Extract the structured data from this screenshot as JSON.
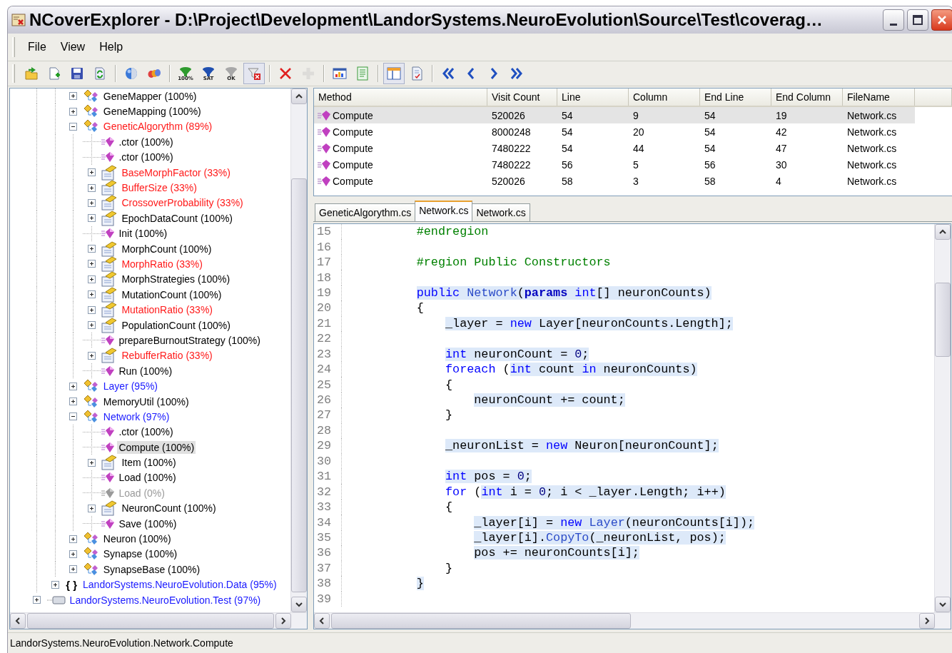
{
  "window": {
    "title": "NCoverExplorer - D:\\Project\\Development\\LandorSystems.NeuroEvolution\\Source\\Test\\coverag…"
  },
  "menu": [
    {
      "label": "File"
    },
    {
      "label": "View"
    },
    {
      "label": "Help"
    }
  ],
  "toolbar": [
    {
      "kind": "open",
      "pressed": false,
      "disabled": false
    },
    {
      "kind": "new",
      "pressed": false,
      "disabled": false
    },
    {
      "kind": "save",
      "pressed": false,
      "disabled": false
    },
    {
      "kind": "reload",
      "pressed": false,
      "disabled": false
    },
    {
      "kind": "separator"
    },
    {
      "kind": "sphere",
      "pressed": false,
      "disabled": false
    },
    {
      "kind": "chain",
      "pressed": false,
      "disabled": false
    },
    {
      "kind": "separator"
    },
    {
      "kind": "filter",
      "caption": "100%",
      "color": "#2e9a2e",
      "pressed": false,
      "disabled": false
    },
    {
      "kind": "filter",
      "caption": "SAT",
      "color": "#2050b0",
      "pressed": false,
      "disabled": false
    },
    {
      "kind": "filter",
      "caption": "OK",
      "color": "#a8a8a8",
      "pressed": false,
      "disabled": false
    },
    {
      "kind": "filter-clear",
      "pressed": true,
      "disabled": false
    },
    {
      "kind": "separator"
    },
    {
      "kind": "delete",
      "pressed": false,
      "disabled": false
    },
    {
      "kind": "add",
      "pressed": false,
      "disabled": true
    },
    {
      "kind": "separator"
    },
    {
      "kind": "report",
      "pressed": false,
      "disabled": false
    },
    {
      "kind": "sheet",
      "pressed": false,
      "disabled": false
    },
    {
      "kind": "separator"
    },
    {
      "kind": "layout",
      "pressed": true,
      "disabled": false
    },
    {
      "kind": "checklist",
      "pressed": false,
      "disabled": false
    },
    {
      "kind": "separator"
    },
    {
      "kind": "first",
      "pressed": false,
      "disabled": false
    },
    {
      "kind": "previous",
      "pressed": false,
      "disabled": false
    },
    {
      "kind": "next",
      "pressed": false,
      "disabled": false
    },
    {
      "kind": "last",
      "pressed": false,
      "disabled": false
    }
  ],
  "tree": {
    "items": [
      {
        "label": "GeneMapper (100%)",
        "kind": "class",
        "color": "#000000",
        "expanded": false,
        "selected": false
      },
      {
        "label": "GeneMapping (100%)",
        "kind": "class",
        "color": "#000000",
        "expanded": false,
        "selected": false
      },
      {
        "label": "GeneticAlgorythm (89%)",
        "kind": "class",
        "color": "#ff1a1a",
        "expanded": true,
        "selected": false,
        "children": [
          {
            "label": ".ctor (100%)",
            "kind": "method",
            "color": "#000000",
            "visited": true,
            "selected": false
          },
          {
            "label": ".ctor (100%)",
            "kind": "method",
            "color": "#000000",
            "visited": true,
            "selected": false
          },
          {
            "label": "BaseMorphFactor (33%)",
            "kind": "property",
            "color": "#ff1a1a",
            "expanded": false,
            "selected": false
          },
          {
            "label": "BufferSize (33%)",
            "kind": "property",
            "color": "#ff1a1a",
            "expanded": false,
            "selected": false
          },
          {
            "label": "CrossoverProbability (33%)",
            "kind": "property",
            "color": "#ff1a1a",
            "expanded": false,
            "selected": false
          },
          {
            "label": "EpochDataCount (100%)",
            "kind": "property",
            "color": "#000000",
            "expanded": false,
            "selected": false
          },
          {
            "label": "Init (100%)",
            "kind": "method",
            "color": "#000000",
            "visited": true,
            "selected": false
          },
          {
            "label": "MorphCount (100%)",
            "kind": "property",
            "color": "#000000",
            "expanded": false,
            "selected": false
          },
          {
            "label": "MorphRatio (33%)",
            "kind": "property",
            "color": "#ff1a1a",
            "expanded": false,
            "selected": false
          },
          {
            "label": "MorphStrategies (100%)",
            "kind": "property",
            "color": "#000000",
            "expanded": false,
            "selected": false
          },
          {
            "label": "MutationCount (100%)",
            "kind": "property",
            "color": "#000000",
            "expanded": false,
            "selected": false
          },
          {
            "label": "MutationRatio (33%)",
            "kind": "property",
            "color": "#ff1a1a",
            "expanded": false,
            "selected": false
          },
          {
            "label": "PopulationCount (100%)",
            "kind": "property",
            "color": "#000000",
            "expanded": false,
            "selected": false
          },
          {
            "label": "prepareBurnoutStrategy (100%)",
            "kind": "method",
            "color": "#000000",
            "visited": true,
            "selected": false
          },
          {
            "label": "RebufferRatio (33%)",
            "kind": "property",
            "color": "#ff1a1a",
            "expanded": false,
            "selected": false
          },
          {
            "label": "Run (100%)",
            "kind": "method",
            "color": "#000000",
            "visited": true,
            "selected": false
          }
        ]
      },
      {
        "label": "Layer (95%)",
        "kind": "class",
        "color": "#1a1aff",
        "expanded": false,
        "selected": false
      },
      {
        "label": "MemoryUtil (100%)",
        "kind": "class",
        "color": "#000000",
        "expanded": false,
        "selected": false
      },
      {
        "label": "Network (97%)",
        "kind": "class",
        "color": "#1a1aff",
        "expanded": true,
        "selected": false,
        "children": [
          {
            "label": ".ctor (100%)",
            "kind": "method",
            "color": "#000000",
            "visited": true,
            "selected": false
          },
          {
            "label": "Compute (100%)",
            "kind": "method",
            "color": "#000000",
            "visited": true,
            "selected": true
          },
          {
            "label": "Item (100%)",
            "kind": "property",
            "color": "#000000",
            "expanded": false,
            "selected": false
          },
          {
            "label": "Load (100%)",
            "kind": "method",
            "color": "#000000",
            "visited": true,
            "selected": false
          },
          {
            "label": "Load (0%)",
            "kind": "method",
            "color": "#9a9a9a",
            "visited": false,
            "selected": false
          },
          {
            "label": "NeuronCount (100%)",
            "kind": "property",
            "color": "#000000",
            "expanded": false,
            "selected": false
          },
          {
            "label": "Save (100%)",
            "kind": "method",
            "color": "#000000",
            "visited": true,
            "selected": false
          }
        ]
      },
      {
        "label": "Neuron (100%)",
        "kind": "class",
        "color": "#000000",
        "expanded": false,
        "selected": false
      },
      {
        "label": "Synapse (100%)",
        "kind": "class",
        "color": "#000000",
        "expanded": false,
        "selected": false
      },
      {
        "label": "SynapseBase (100%)",
        "kind": "class",
        "color": "#000000",
        "expanded": false,
        "selected": false
      },
      {
        "label": "LandorSystems.NeuroEvolution.Data (95%)",
        "kind": "namespace",
        "glyph": "{ }",
        "color": "#1a1aff",
        "expanded": false,
        "selected": false
      },
      {
        "label": "LandorSystems.NeuroEvolution.Test (97%)",
        "kind": "assembly",
        "color": "#1a1aff",
        "expanded": false,
        "selected": false
      }
    ]
  },
  "table": {
    "columns": [
      "Method",
      "Visit Count",
      "Line",
      "Column",
      "End Line",
      "End Column",
      "FileName"
    ],
    "rows": [
      {
        "cells": [
          "Compute",
          "520026",
          "54",
          "9",
          "54",
          "19",
          "Network.cs"
        ],
        "selected": true
      },
      {
        "cells": [
          "Compute",
          "8000248",
          "54",
          "20",
          "54",
          "42",
          "Network.cs"
        ],
        "selected": false
      },
      {
        "cells": [
          "Compute",
          "7480222",
          "54",
          "44",
          "54",
          "47",
          "Network.cs"
        ],
        "selected": false
      },
      {
        "cells": [
          "Compute",
          "7480222",
          "56",
          "5",
          "56",
          "30",
          "Network.cs"
        ],
        "selected": false
      },
      {
        "cells": [
          "Compute",
          "520026",
          "58",
          "3",
          "58",
          "4",
          "Network.cs"
        ],
        "selected": false
      }
    ]
  },
  "tabs": [
    {
      "label": "GeneticAlgorythm.cs",
      "selected": false
    },
    {
      "label": "Network.cs",
      "selected": true
    },
    {
      "label": "Network.cs",
      "selected": false
    }
  ],
  "code": {
    "lines": [
      {
        "number": "15",
        "tokens": [
          {
            "text": "          #endregion",
            "kind": "directive",
            "covered": false
          }
        ]
      },
      {
        "number": "16"
      },
      {
        "number": "17",
        "tokens": [
          {
            "text": "          #region Public Constructors",
            "kind": "directive",
            "covered": false
          }
        ]
      },
      {
        "number": "18"
      },
      {
        "number": "19",
        "tokens": [
          {
            "text": "          public ",
            "kind": "keyword",
            "covered": true
          },
          {
            "text": "Network",
            "kind": "type",
            "covered": true
          },
          {
            "text": "(",
            "kind": "plain",
            "covered": true
          },
          {
            "text": "params",
            "kind": "strong",
            "covered": true
          },
          {
            "text": " int",
            "kind": "keyword",
            "covered": true
          },
          {
            "text": "[] neuronCounts)",
            "kind": "plain",
            "covered": true
          }
        ]
      },
      {
        "number": "20",
        "tokens": [
          {
            "text": "          {",
            "kind": "plain",
            "covered": false
          }
        ]
      },
      {
        "number": "21",
        "tokens": [
          {
            "text": "              _layer = ",
            "kind": "plain",
            "covered": true
          },
          {
            "text": "new",
            "kind": "keyword",
            "covered": true
          },
          {
            "text": " Layer[neuronCounts.Length];",
            "kind": "plain",
            "covered": true
          }
        ]
      },
      {
        "number": "22"
      },
      {
        "number": "23",
        "tokens": [
          {
            "text": "              int",
            "kind": "keyword",
            "covered": true
          },
          {
            "text": " neuronCount = ",
            "kind": "plain",
            "covered": true
          },
          {
            "text": "0",
            "kind": "number",
            "covered": true
          },
          {
            "text": ";",
            "kind": "plain",
            "covered": true
          }
        ]
      },
      {
        "number": "24",
        "tokens": [
          {
            "text": "              foreach",
            "kind": "keyword",
            "covered": false
          },
          {
            "text": " (",
            "kind": "plain",
            "covered": false
          },
          {
            "text": "int",
            "kind": "keyword",
            "covered": true
          },
          {
            "text": " count ",
            "kind": "plain",
            "covered": true
          },
          {
            "text": "in",
            "kind": "keyword",
            "covered": true
          },
          {
            "text": " neuronCounts)",
            "kind": "plain",
            "covered": true
          }
        ]
      },
      {
        "number": "25",
        "tokens": [
          {
            "text": "              {",
            "kind": "plain",
            "covered": false
          }
        ]
      },
      {
        "number": "26",
        "tokens": [
          {
            "text": "                  neuronCount += count;",
            "kind": "plain",
            "covered": true
          }
        ]
      },
      {
        "number": "27",
        "tokens": [
          {
            "text": "              }",
            "kind": "plain",
            "covered": false
          }
        ]
      },
      {
        "number": "28"
      },
      {
        "number": "29",
        "tokens": [
          {
            "text": "              _neuronList = ",
            "kind": "plain",
            "covered": true
          },
          {
            "text": "new",
            "kind": "keyword",
            "covered": true
          },
          {
            "text": " Neuron[neuronCount];",
            "kind": "plain",
            "covered": true
          }
        ]
      },
      {
        "number": "30"
      },
      {
        "number": "31",
        "tokens": [
          {
            "text": "              int",
            "kind": "keyword",
            "covered": true
          },
          {
            "text": " pos = ",
            "kind": "plain",
            "covered": true
          },
          {
            "text": "0",
            "kind": "number",
            "covered": true
          },
          {
            "text": ";",
            "kind": "plain",
            "covered": true
          }
        ]
      },
      {
        "number": "32",
        "tokens": [
          {
            "text": "              for",
            "kind": "keyword",
            "covered": false
          },
          {
            "text": " (",
            "kind": "plain",
            "covered": false
          },
          {
            "text": "int",
            "kind": "keyword",
            "covered": true
          },
          {
            "text": " i = ",
            "kind": "plain",
            "covered": true
          },
          {
            "text": "0",
            "kind": "number",
            "covered": true
          },
          {
            "text": "; i < _layer.Length;",
            "kind": "plain",
            "covered": true
          },
          {
            "text": " i++)",
            "kind": "plain",
            "covered": true
          }
        ]
      },
      {
        "number": "33",
        "tokens": [
          {
            "text": "              {",
            "kind": "plain",
            "covered": false
          }
        ]
      },
      {
        "number": "34",
        "tokens": [
          {
            "text": "                  _layer[i] = ",
            "kind": "plain",
            "covered": true
          },
          {
            "text": "new ",
            "kind": "keyword",
            "covered": true
          },
          {
            "text": "Layer",
            "kind": "type",
            "covered": true
          },
          {
            "text": "(neuronCounts[i]);",
            "kind": "plain",
            "covered": true
          }
        ]
      },
      {
        "number": "35",
        "tokens": [
          {
            "text": "                  _layer[i].",
            "kind": "plain",
            "covered": true
          },
          {
            "text": "CopyTo",
            "kind": "type",
            "covered": true
          },
          {
            "text": "(_neuronList, pos);",
            "kind": "plain",
            "covered": true
          }
        ]
      },
      {
        "number": "36",
        "tokens": [
          {
            "text": "                  pos += neuronCounts[i];",
            "kind": "plain",
            "covered": true
          }
        ]
      },
      {
        "number": "37",
        "tokens": [
          {
            "text": "              }",
            "kind": "plain",
            "covered": false
          }
        ]
      },
      {
        "number": "38",
        "tokens": [
          {
            "text": "          }",
            "kind": "plain",
            "covered": true
          }
        ]
      },
      {
        "number": "39"
      }
    ]
  },
  "status_bar": {
    "text": "LandorSystems.NeuroEvolution.Network.Compute"
  }
}
